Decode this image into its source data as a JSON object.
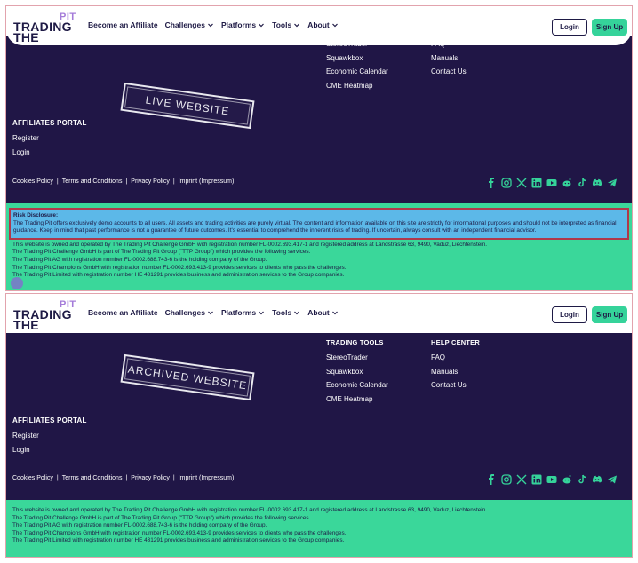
{
  "brand": {
    "pit": "PIT",
    "trading": "TRADING",
    "the": "THE"
  },
  "nav": {
    "items": [
      {
        "label": "Become an Affiliate",
        "chevron": false
      },
      {
        "label": "Challenges",
        "chevron": true
      },
      {
        "label": "Platforms",
        "chevron": true
      },
      {
        "label": "Tools",
        "chevron": true
      },
      {
        "label": "About",
        "chevron": true
      }
    ],
    "login": "Login",
    "signup": "Sign Up"
  },
  "footer": {
    "trading_tools": {
      "head": "TRADING TOOLS",
      "links": [
        "StereoTrader",
        "Squawkbox",
        "Economic Calendar",
        "CME Heatmap"
      ]
    },
    "help_center": {
      "head": "HELP CENTER",
      "links": [
        "FAQ",
        "Manuals",
        "Contact Us"
      ]
    },
    "affiliates": {
      "head": "AFFILIATES PORTAL",
      "links": [
        "Register",
        "Login"
      ]
    },
    "legal": [
      "Cookies Policy",
      "Terms and Conditions",
      "Privacy Policy",
      "Imprint (Impressum)"
    ],
    "social_icons": [
      "facebook-icon",
      "instagram-icon",
      "x-icon",
      "linkedin-icon",
      "youtube-icon",
      "reddit-icon",
      "tiktok-icon",
      "discord-icon",
      "telegram-icon"
    ]
  },
  "stamps": {
    "live": "LIVE WEBSITE",
    "archived": "ARCHIVED WEBSITE"
  },
  "risk": {
    "title": "Risk Disclosure:",
    "text": "The Trading Pit offers exclusively demo accounts to all users. All assets and trading activities are purely virtual. The content and information available on this site are strictly for informational purposes and should not be interpreted as financial guidance. Keep in mind that past performance is not a guarantee of future outcomes. It's essential to comprehend the inherent risks of trading. If uncertain, always consult with an independent financial advisor."
  },
  "company_lines": [
    "This website is owned and operated by The Trading Pit Challenge GmbH with registration number FL-0002.693.417-1 and registered address at Landstrasse 63, 9490, Vaduz, Liechtenstein.",
    "The Trading Pit Challenge GmbH is part of The Trading Pit Group (\"TTP Group\") which provides the following services.",
    "The Trading Pit AG with registration number FL-0002.688.743-6 is the holding company of the Group.",
    "The Trading Pit Champions GmbH with registration number FL-0002.693.413-9 provides services to clients who pass the challenges.",
    "The Trading Pit Limited with registration number HE 431291 provides business and administration services to the Group companies."
  ],
  "colors": {
    "navy": "#201646",
    "green": "#3ad79a",
    "risk_bg": "#5cb8e8",
    "risk_border": "#b0384b",
    "purple": "#a47bd9"
  }
}
